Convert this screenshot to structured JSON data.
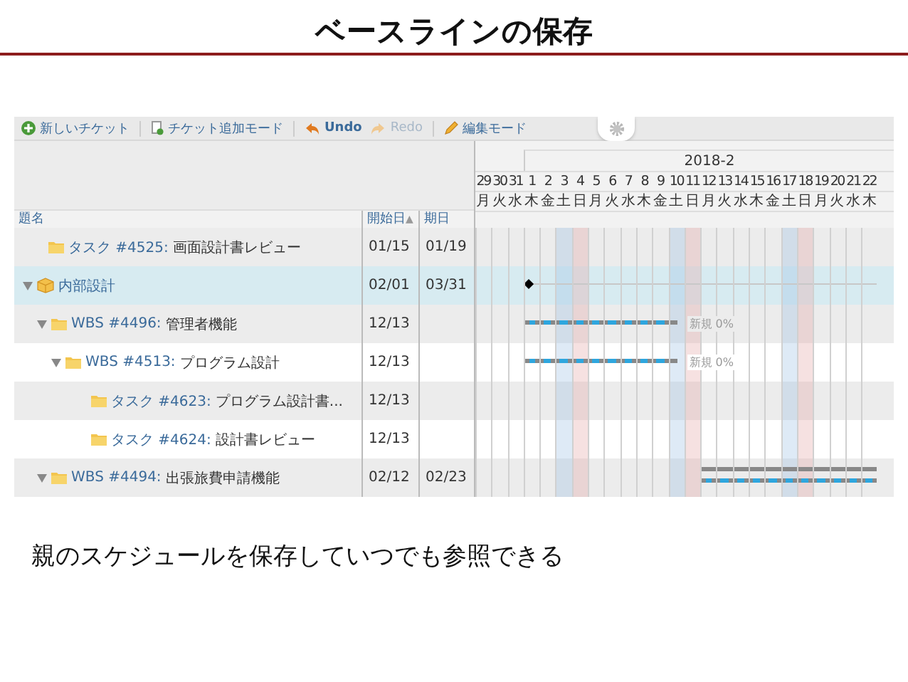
{
  "slide": {
    "title": "ベースラインの保存",
    "caption": "親のスケジュールを保存していつでも参照できる"
  },
  "toolbar": [
    {
      "kind": "new",
      "label": "新しいチケット",
      "disabled": false
    },
    {
      "kind": "add",
      "label": "チケット追加モード",
      "disabled": false
    },
    {
      "kind": "undo",
      "label": "Undo",
      "disabled": false
    },
    {
      "kind": "redo",
      "label": "Redo",
      "disabled": true
    },
    {
      "kind": "edit",
      "label": "編集モード",
      "disabled": false
    }
  ],
  "table": {
    "columns": [
      {
        "label": "題名"
      },
      {
        "label": "開始日",
        "sort": "▲"
      },
      {
        "label": "期日"
      }
    ],
    "rows": [
      {
        "kind": "task",
        "tracker": "タスク #4525:",
        "subject": "画面設計書レビュー",
        "start": "01/15",
        "due": "01/19",
        "selected": false
      },
      {
        "kind": "project",
        "subject": "内部設計",
        "start": "02/01",
        "due": "03/31",
        "selected": true,
        "expanded": true,
        "bars": [
          {
            "kind": "milestone",
            "days": [
              false,
              false,
              false,
              true,
              false,
              false,
              false,
              false,
              false,
              false,
              false,
              false,
              false,
              false,
              false,
              false,
              false,
              false,
              false,
              false,
              false,
              false,
              false,
              false,
              false
            ]
          }
        ],
        "children": [
          {
            "kind": "wbs",
            "tracker": "WBS #4496:",
            "subject": "管理者機能",
            "start": "12/13",
            "selected": false,
            "expanded": true,
            "bars": [
              {
                "kind": "plan",
                "label": "新規 0%",
                "days": [
                  false,
                  false,
                  false,
                  true,
                  true,
                  true,
                  true,
                  true,
                  true,
                  true,
                  true,
                  true,
                  true,
                  false,
                  false,
                  false,
                  false,
                  false,
                  false,
                  false,
                  false,
                  false,
                  false,
                  false,
                  false
                ]
              }
            ],
            "children": [
              {
                "kind": "wbs",
                "tracker": "WBS #4513:",
                "subject": "プログラム設計",
                "start": "12/13",
                "selected": false,
                "expanded": true,
                "bars": [
                  {
                    "kind": "plan",
                    "label": "新規 0%",
                    "days": [
                      false,
                      false,
                      false,
                      true,
                      true,
                      true,
                      true,
                      true,
                      true,
                      true,
                      true,
                      true,
                      true,
                      false,
                      false,
                      false,
                      false,
                      false,
                      false,
                      false,
                      false,
                      false,
                      false,
                      false,
                      false
                    ]
                  }
                ],
                "children": [
                  {
                    "kind": "task",
                    "tracker": "タスク #4623:",
                    "subject": "プログラム設計書...",
                    "start": "12/13",
                    "selected": false
                  },
                  {
                    "kind": "task",
                    "tracker": "タスク #4624:",
                    "subject": "設計書レビュー",
                    "start": "12/13",
                    "selected": false
                  }
                ]
              }
            ]
          },
          {
            "kind": "wbs",
            "tracker": "WBS #4494:",
            "subject": "出張旅費申請機能",
            "start": "02/12",
            "due": "02/23",
            "selected": false,
            "expanded": true,
            "bars": [
              {
                "kind": "baseline",
                "days": [
                  false,
                  false,
                  false,
                  false,
                  false,
                  false,
                  false,
                  false,
                  false,
                  false,
                  false,
                  false,
                  false,
                  false,
                  true,
                  true,
                  true,
                  true,
                  true,
                  true,
                  true,
                  true,
                  true,
                  true,
                  true
                ]
              },
              {
                "kind": "plan",
                "days": [
                  false,
                  false,
                  false,
                  false,
                  false,
                  false,
                  false,
                  false,
                  false,
                  false,
                  false,
                  false,
                  false,
                  false,
                  true,
                  true,
                  true,
                  true,
                  true,
                  true,
                  true,
                  true,
                  true,
                  true,
                  true
                ]
              }
            ]
          }
        ]
      }
    ]
  },
  "gantt": {
    "month": "2018-2",
    "days": [
      {
        "day": "29",
        "weekday": "月",
        "kind": "weekday"
      },
      {
        "day": "30",
        "weekday": "火",
        "kind": "weekday"
      },
      {
        "day": "31",
        "weekday": "水",
        "kind": "weekday"
      },
      {
        "day": "1",
        "weekday": "木",
        "kind": "weekday"
      },
      {
        "day": "2",
        "weekday": "金",
        "kind": "weekday"
      },
      {
        "day": "3",
        "weekday": "土",
        "kind": "sat"
      },
      {
        "day": "4",
        "weekday": "日",
        "kind": "sun"
      },
      {
        "day": "5",
        "weekday": "月",
        "kind": "weekday"
      },
      {
        "day": "6",
        "weekday": "火",
        "kind": "weekday"
      },
      {
        "day": "7",
        "weekday": "水",
        "kind": "weekday"
      },
      {
        "day": "8",
        "weekday": "木",
        "kind": "weekday"
      },
      {
        "day": "9",
        "weekday": "金",
        "kind": "weekday"
      },
      {
        "day": "10",
        "weekday": "土",
        "kind": "sat"
      },
      {
        "day": "11",
        "weekday": "日",
        "kind": "sun"
      },
      {
        "day": "12",
        "weekday": "月",
        "kind": "weekday"
      },
      {
        "day": "13",
        "weekday": "火",
        "kind": "weekday"
      },
      {
        "day": "14",
        "weekday": "水",
        "kind": "weekday"
      },
      {
        "day": "15",
        "weekday": "木",
        "kind": "weekday"
      },
      {
        "day": "16",
        "weekday": "金",
        "kind": "weekday"
      },
      {
        "day": "17",
        "weekday": "土",
        "kind": "sat"
      },
      {
        "day": "18",
        "weekday": "日",
        "kind": "sun"
      },
      {
        "day": "19",
        "weekday": "月",
        "kind": "weekday"
      },
      {
        "day": "20",
        "weekday": "火",
        "kind": "weekday"
      },
      {
        "day": "21",
        "weekday": "水",
        "kind": "weekday"
      },
      {
        "day": "22",
        "weekday": "木",
        "kind": "weekday"
      }
    ]
  }
}
